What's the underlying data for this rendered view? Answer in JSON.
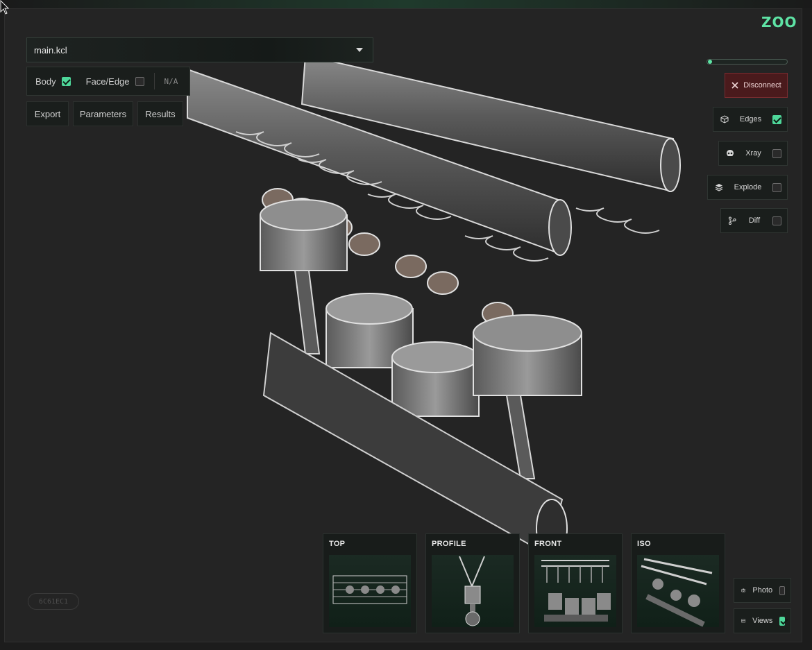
{
  "brand": {
    "logo_text": "ZOO",
    "accent": "#5ee3a5",
    "danger": "#4a1a1c"
  },
  "file": {
    "name": "main.kcl"
  },
  "selection": {
    "body_label": "Body",
    "body_checked": true,
    "face_edge_label": "Face/Edge",
    "face_edge_checked": false,
    "value": "N/A"
  },
  "tabs": [
    {
      "label": "Export"
    },
    {
      "label": "Parameters"
    },
    {
      "label": "Results"
    }
  ],
  "connection": {
    "disconnect_label": "Disconnect"
  },
  "toggles": [
    {
      "label": "Edges",
      "icon": "cube-icon",
      "checked": true
    },
    {
      "label": "Xray",
      "icon": "skull-icon",
      "checked": false
    },
    {
      "label": "Explode",
      "icon": "layers-icon",
      "checked": false
    },
    {
      "label": "Diff",
      "icon": "branch-icon",
      "checked": false
    },
    {
      "label": "Photo",
      "icon": "camera-icon",
      "checked": false
    },
    {
      "label": "Views",
      "icon": "grid-icon",
      "checked": true
    }
  ],
  "views": [
    {
      "label": "TOP"
    },
    {
      "label": "PROFILE"
    },
    {
      "label": "FRONT"
    },
    {
      "label": "ISO"
    }
  ],
  "commit_hash": "6C61EC1",
  "slider_value": 0
}
